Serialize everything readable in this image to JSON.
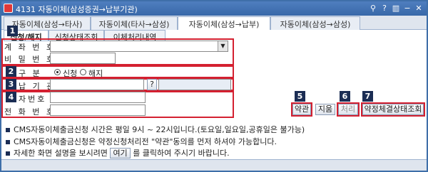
{
  "window": {
    "title": "4131 자동이체(삼성증권→납부기관)",
    "icons": [
      "app-icon",
      "pin-icon",
      "help-icon",
      "menu-icon",
      "minimize-icon",
      "close-icon"
    ]
  },
  "top_tabs": [
    {
      "label": "자동이체(삼성→타사)"
    },
    {
      "label": "자동이체(타사→삼성)"
    },
    {
      "label": "자동이체(삼성→납부)"
    },
    {
      "label": "자동이체(삼성→삼성)"
    }
  ],
  "sub_tabs": [
    {
      "label": "신청/해지"
    },
    {
      "label": "신청상태조회"
    },
    {
      "label": "이체처리내역"
    }
  ],
  "markers": [
    "1",
    "2",
    "3",
    "4",
    "5",
    "6",
    "7"
  ],
  "form": {
    "account_label": "계 좌 번 호",
    "password_label": "비 밀 번 호",
    "category_label": "구 분",
    "radio_apply": "신청",
    "radio_cancel": "해지",
    "institution_label": "납 기 관",
    "payer_number_label": "자번호",
    "phone_label": "전 화 번 호",
    "search_button": "?"
  },
  "buttons": {
    "terms": "약관",
    "clear": "지움",
    "process": "처리",
    "agreement_inquiry": "약정체결상태조회"
  },
  "info": {
    "line1": "CMS자동이체출금신청 시간은 평일 9시 ~ 22시입니다.(토요일,일요일,공휴일은 불가능)",
    "line2": "CMS자동이체출금신청은 약정신청처리전 \"약관\"동의를 먼저 하셔야 가능합니다.",
    "line3_before": "자세한 화면 설명을 보시려면",
    "line3_link": "여기",
    "line3_after": "를 클릭하여 주시기 바랍니다."
  }
}
